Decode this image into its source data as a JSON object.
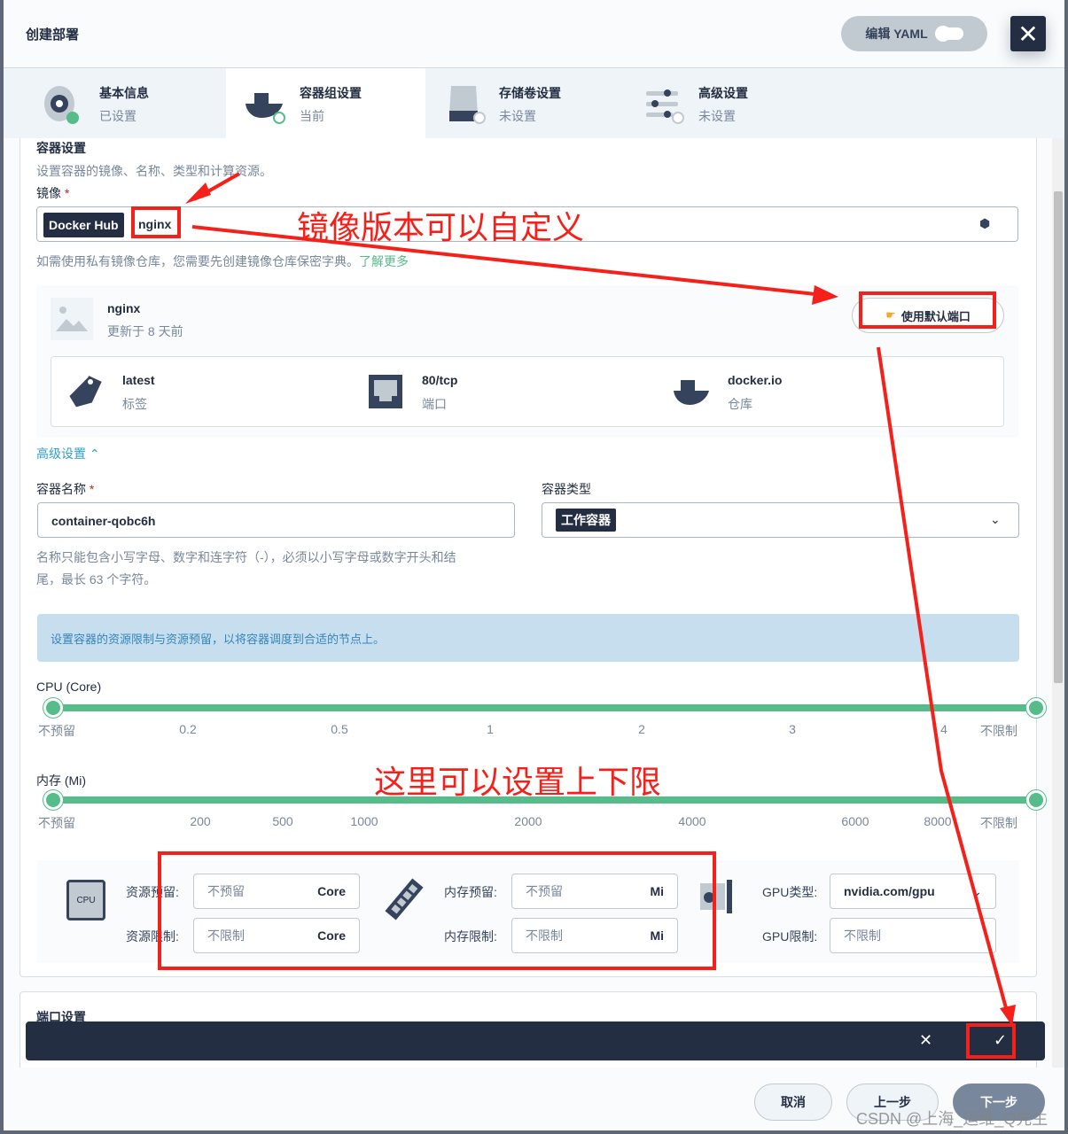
{
  "header": {
    "title": "创建部署",
    "yaml_label": "编辑 YAML",
    "close_icon": "close-icon"
  },
  "steps": [
    {
      "title": "基本信息",
      "status": "已设置"
    },
    {
      "title": "容器组设置",
      "status": "当前"
    },
    {
      "title": "存储卷设置",
      "status": "未设置"
    },
    {
      "title": "高级设置",
      "status": "未设置"
    }
  ],
  "container": {
    "section_title": "容器设置",
    "section_desc": "设置容器的镜像、名称、类型和计算资源。",
    "image_label": "镜像",
    "required_mark": "*",
    "registry": "Docker Hub",
    "image_value": "nginx",
    "image_hint": "如需使用私有镜像仓库，您需要先创建镜像仓库保密字典。",
    "learn_more": "了解更多",
    "image_name": "nginx",
    "image_updated": "更新于 8 天前",
    "use_default_port": "使用默认端口",
    "info": [
      {
        "value": "latest",
        "label": "标签"
      },
      {
        "value": "80/tcp",
        "label": "端口"
      },
      {
        "value": "docker.io",
        "label": "仓库"
      }
    ],
    "advanced_toggle": "高级设置",
    "name_label": "容器名称",
    "name_value": "container-qobc6h",
    "name_hint1": "名称只能包含小写字母、数字和连字符（-），必须以小写字母或数字开头和结",
    "name_hint2": "尾，最长 63 个字符。",
    "type_label": "容器类型",
    "type_value": "工作容器",
    "resource_banner": "设置容器的资源限制与资源预留，以将容器调度到合适的节点上。",
    "cpu_label": "CPU (Core)",
    "cpu_ticks": [
      "不预留",
      "0.2",
      "0.5",
      "1",
      "2",
      "3",
      "4",
      "不限制"
    ],
    "cpu_range": [
      "不预留",
      "不限制"
    ],
    "mem_label": "内存 (Mi)",
    "mem_ticks": [
      "不预留",
      "200",
      "500",
      "1000",
      "2000",
      "4000",
      "6000",
      "8000",
      "不限制"
    ],
    "mem_range": [
      "不预留",
      "不限制"
    ],
    "cpu_icon_text": "CPU",
    "res_request_label": "资源预留:",
    "res_limit_label": "资源限制:",
    "cpu_request_ph": "不预留",
    "cpu_limit_ph": "不限制",
    "cpu_unit": "Core",
    "mem_request_label": "内存预留:",
    "mem_limit_label": "内存限制:",
    "mem_request_ph": "不预留",
    "mem_limit_ph": "不限制",
    "mem_unit": "Mi",
    "gpu_type_label": "GPU类型:",
    "gpu_type_value": "nvidia.com/gpu",
    "gpu_limit_label": "GPU限制:",
    "gpu_limit_ph": "不限制"
  },
  "ports": {
    "title": "端口设置"
  },
  "confirm_bar": {
    "cancel_icon": "close-icon",
    "confirm_icon": "check-icon"
  },
  "footer": {
    "cancel": "取消",
    "prev": "上一步",
    "next": "下一步"
  },
  "annotations": {
    "image_note": "镜像版本可以自定义",
    "limit_note": "这里可以设置上下限",
    "color": "#f5201a"
  },
  "watermark": "CSDN @上海_运维_Q先生"
}
